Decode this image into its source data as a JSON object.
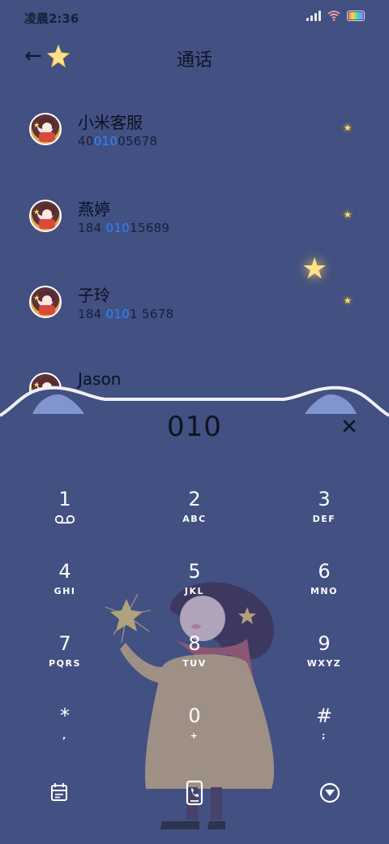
{
  "status": {
    "time": "凌晨2:36"
  },
  "header": {
    "title": "通话"
  },
  "contacts": [
    {
      "name": "小米客服",
      "number_pre": "40",
      "number_hl": "010",
      "number_post": "05678"
    },
    {
      "name": "燕婷",
      "number_pre": "184 ",
      "number_hl": "010",
      "number_post": "15689"
    },
    {
      "name": "子玲",
      "number_pre": "184 ",
      "number_hl": "010",
      "number_post": "1 5678"
    },
    {
      "name": "Jason",
      "number_pre": "",
      "number_hl": "",
      "number_post": ""
    }
  ],
  "dial": {
    "digits": "010",
    "clear_icon": "close-icon"
  },
  "keys": [
    {
      "digit": "1",
      "letters": "",
      "icon": "voicemail-icon"
    },
    {
      "digit": "2",
      "letters": "ABC"
    },
    {
      "digit": "3",
      "letters": "DEF"
    },
    {
      "digit": "4",
      "letters": "GHI"
    },
    {
      "digit": "5",
      "letters": "JKL"
    },
    {
      "digit": "6",
      "letters": "MNO"
    },
    {
      "digit": "7",
      "letters": "PQRS"
    },
    {
      "digit": "8",
      "letters": "TUV"
    },
    {
      "digit": "9",
      "letters": "WXYZ"
    },
    {
      "digit": "*",
      "letters": ","
    },
    {
      "digit": "0",
      "letters": "+"
    },
    {
      "digit": "#",
      "letters": ";"
    }
  ],
  "bottom_bar": {
    "left_icon": "calendar-icon",
    "center_icon": "phone-call-icon",
    "right_icon": "collapse-dialpad-icon"
  },
  "colors": {
    "background": "#425082",
    "highlight": "#2b86ff",
    "star": "#ffe066"
  }
}
